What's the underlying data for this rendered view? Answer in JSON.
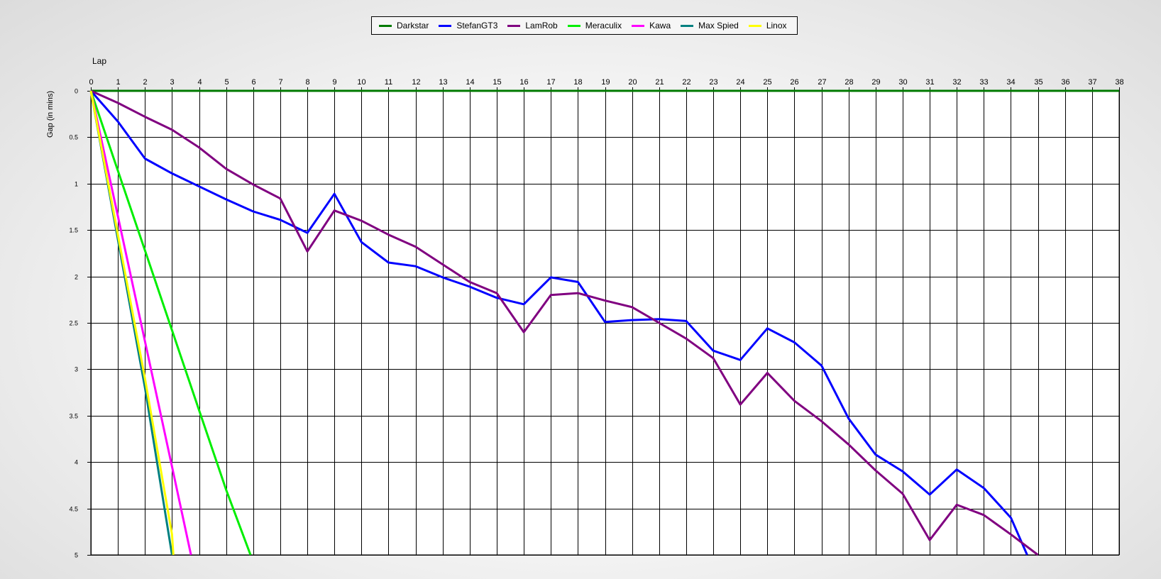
{
  "chart_data": {
    "type": "line",
    "xlabel": "Lap",
    "ylabel": "Gap (in mins)",
    "xlim": [
      0,
      38
    ],
    "ylim": [
      0,
      5
    ],
    "y_inverted": true,
    "x_ticks": [
      0,
      1,
      2,
      3,
      4,
      5,
      6,
      7,
      8,
      9,
      10,
      11,
      12,
      13,
      14,
      15,
      16,
      17,
      18,
      19,
      20,
      21,
      22,
      23,
      24,
      25,
      26,
      27,
      28,
      29,
      30,
      31,
      32,
      33,
      34,
      35,
      36,
      37,
      38
    ],
    "y_ticks": [
      0,
      0.5,
      1,
      1.5,
      2,
      2.5,
      3,
      3.5,
      4,
      4.5,
      5
    ],
    "y_tick_labels": [
      "0",
      "0.5",
      "1",
      "1.5",
      "2",
      "2.5",
      "3",
      "3.5",
      "4",
      "4.5",
      "5"
    ],
    "grid": true,
    "legend_position": "top-center",
    "series": [
      {
        "name": "Darkstar",
        "color": "#007a00",
        "points": [
          [
            0,
            0
          ],
          [
            38,
            0
          ]
        ]
      },
      {
        "name": "StefanGT3",
        "color": "#0000ff",
        "points": [
          [
            0,
            0
          ],
          [
            1,
            0.33
          ],
          [
            2,
            0.73
          ],
          [
            3,
            0.89
          ],
          [
            4,
            1.03
          ],
          [
            5,
            1.17
          ],
          [
            6,
            1.3
          ],
          [
            7,
            1.39
          ],
          [
            8,
            1.53
          ],
          [
            9,
            1.11
          ],
          [
            10,
            1.63
          ],
          [
            11,
            1.85
          ],
          [
            12,
            1.89
          ],
          [
            13,
            2.01
          ],
          [
            14,
            2.11
          ],
          [
            15,
            2.23
          ],
          [
            16,
            2.3
          ],
          [
            17,
            2.01
          ],
          [
            18,
            2.06
          ],
          [
            19,
            2.49
          ],
          [
            20,
            2.47
          ],
          [
            21,
            2.46
          ],
          [
            22,
            2.48
          ],
          [
            23,
            2.8
          ],
          [
            24,
            2.9
          ],
          [
            25,
            2.56
          ],
          [
            26,
            2.71
          ],
          [
            27,
            2.96
          ],
          [
            28,
            3.53
          ],
          [
            29,
            3.92
          ],
          [
            30,
            4.1
          ],
          [
            31,
            4.35
          ],
          [
            32,
            4.08
          ],
          [
            33,
            4.28
          ],
          [
            34,
            4.6
          ],
          [
            34.6,
            5
          ]
        ]
      },
      {
        "name": "LamRob",
        "color": "#800080",
        "points": [
          [
            0,
            0
          ],
          [
            1,
            0.13
          ],
          [
            2,
            0.28
          ],
          [
            3,
            0.42
          ],
          [
            4,
            0.61
          ],
          [
            5,
            0.84
          ],
          [
            6,
            1.01
          ],
          [
            7,
            1.16
          ],
          [
            8,
            1.73
          ],
          [
            9,
            1.29
          ],
          [
            10,
            1.4
          ],
          [
            11,
            1.55
          ],
          [
            12,
            1.68
          ],
          [
            13,
            1.87
          ],
          [
            14,
            2.06
          ],
          [
            15,
            2.18
          ],
          [
            16,
            2.6
          ],
          [
            17,
            2.2
          ],
          [
            18,
            2.18
          ],
          [
            19,
            2.26
          ],
          [
            20,
            2.33
          ],
          [
            21,
            2.5
          ],
          [
            22,
            2.67
          ],
          [
            23,
            2.88
          ],
          [
            24,
            3.38
          ],
          [
            25,
            3.04
          ],
          [
            26,
            3.34
          ],
          [
            27,
            3.56
          ],
          [
            28,
            3.81
          ],
          [
            29,
            4.09
          ],
          [
            30,
            4.34
          ],
          [
            31,
            4.84
          ],
          [
            32,
            4.46
          ],
          [
            33,
            4.57
          ],
          [
            34,
            4.78
          ],
          [
            35,
            5
          ]
        ]
      },
      {
        "name": "Meraculix",
        "color": "#00ee00",
        "points": [
          [
            0,
            0
          ],
          [
            1,
            0.86
          ],
          [
            2,
            1.72
          ],
          [
            3,
            2.58
          ],
          [
            4,
            3.44
          ],
          [
            5,
            4.3
          ],
          [
            5.9,
            5
          ]
        ]
      },
      {
        "name": "Kawa",
        "color": "#ff00ff",
        "points": [
          [
            0,
            0
          ],
          [
            1,
            1.35
          ],
          [
            2,
            2.7
          ],
          [
            3,
            4.05
          ],
          [
            3.7,
            5
          ]
        ]
      },
      {
        "name": "Max Spied",
        "color": "#008080",
        "points": [
          [
            0,
            0
          ],
          [
            1,
            1.6
          ],
          [
            2,
            3.2
          ],
          [
            3,
            5
          ]
        ]
      },
      {
        "name": "Linox",
        "color": "#ffff00",
        "points": [
          [
            0,
            0
          ],
          [
            1,
            1.55
          ],
          [
            2,
            3.1
          ],
          [
            3,
            4.78
          ],
          [
            3.05,
            5
          ]
        ]
      }
    ]
  }
}
